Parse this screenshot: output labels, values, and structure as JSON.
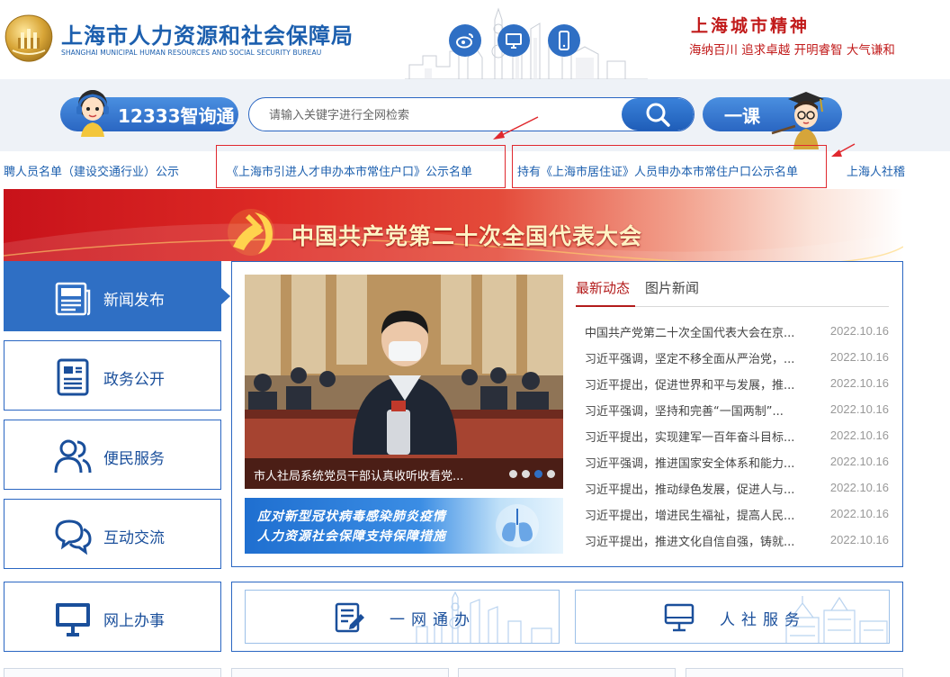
{
  "header": {
    "title": "上海市人力资源和社会保障局",
    "subtitle": "SHANGHAI MUNICIPAL HUMAN RESOURCES AND SOCIAL SECURITY BUREAU",
    "social_icons": [
      "weibo-icon",
      "desktop-icon",
      "mobile-icon"
    ],
    "spirit_title": "上海城市精神",
    "spirit_words": "海纳百川  追求卓越  开明睿智  大气谦和"
  },
  "search": {
    "assistant_label": "12333智询通",
    "placeholder": "请输入关键字进行全网检索",
    "value": "",
    "course_label": "一课"
  },
  "marquee": {
    "items": [
      "聘人员名单（建设交通行业）公示",
      "《上海市引进人才申办本市常住户口》公示名单",
      "持有《上海市居住证》人员申办本市常住户口公示名单",
      "上海人社稽"
    ]
  },
  "congress_banner": {
    "text": "中国共产党第二十次全国代表大会"
  },
  "nav": {
    "items": [
      {
        "label": "新闻发布",
        "icon": "newspaper-icon",
        "active": true
      },
      {
        "label": "政务公开",
        "icon": "document-icon",
        "active": false
      },
      {
        "label": "便民服务",
        "icon": "people-icon",
        "active": false
      },
      {
        "label": "互动交流",
        "icon": "chat-bubbles-icon",
        "active": false
      },
      {
        "label": "网上办事",
        "icon": "monitor-icon",
        "active": false
      }
    ]
  },
  "slider": {
    "caption": "市人社局系统党员干部认真收听收看党...",
    "dot_count": 4,
    "active_dot": 3
  },
  "covid_banner": {
    "line1": "应对新型冠状病毒感染肺炎疫情",
    "line2": "人力资源社会保障支持保障措施"
  },
  "tabs": {
    "latest": "最新动态",
    "photo": "图片新闻"
  },
  "news": [
    {
      "title": "中国共产党第二十次全国代表大会在京...",
      "date": "2022.10.16"
    },
    {
      "title": "习近平强调，坚定不移全面从严治党，...",
      "date": "2022.10.16"
    },
    {
      "title": "习近平提出，促进世界和平与发展，推...",
      "date": "2022.10.16"
    },
    {
      "title": "习近平强调，坚持和完善“一国两制”...",
      "date": "2022.10.16"
    },
    {
      "title": "习近平提出，实现建军一百年奋斗目标...",
      "date": "2022.10.16"
    },
    {
      "title": "习近平强调，推进国家安全体系和能力...",
      "date": "2022.10.16"
    },
    {
      "title": "习近平提出，推动绿色发展，促进人与...",
      "date": "2022.10.16"
    },
    {
      "title": "习近平提出，增进民生福祉，提高人民...",
      "date": "2022.10.16"
    },
    {
      "title": "习近平提出，推进文化自信自强，铸就...",
      "date": "2022.10.16"
    }
  ],
  "services": {
    "one_stop": "一网通办",
    "hr_service": "人社服务"
  },
  "colors": {
    "brand_blue": "#2f6fc4",
    "title_blue": "#1c5fae",
    "spirit_red": "#c11a1a",
    "active_tab_red": "#b31b1b",
    "annotation_red": "#e0282e"
  }
}
